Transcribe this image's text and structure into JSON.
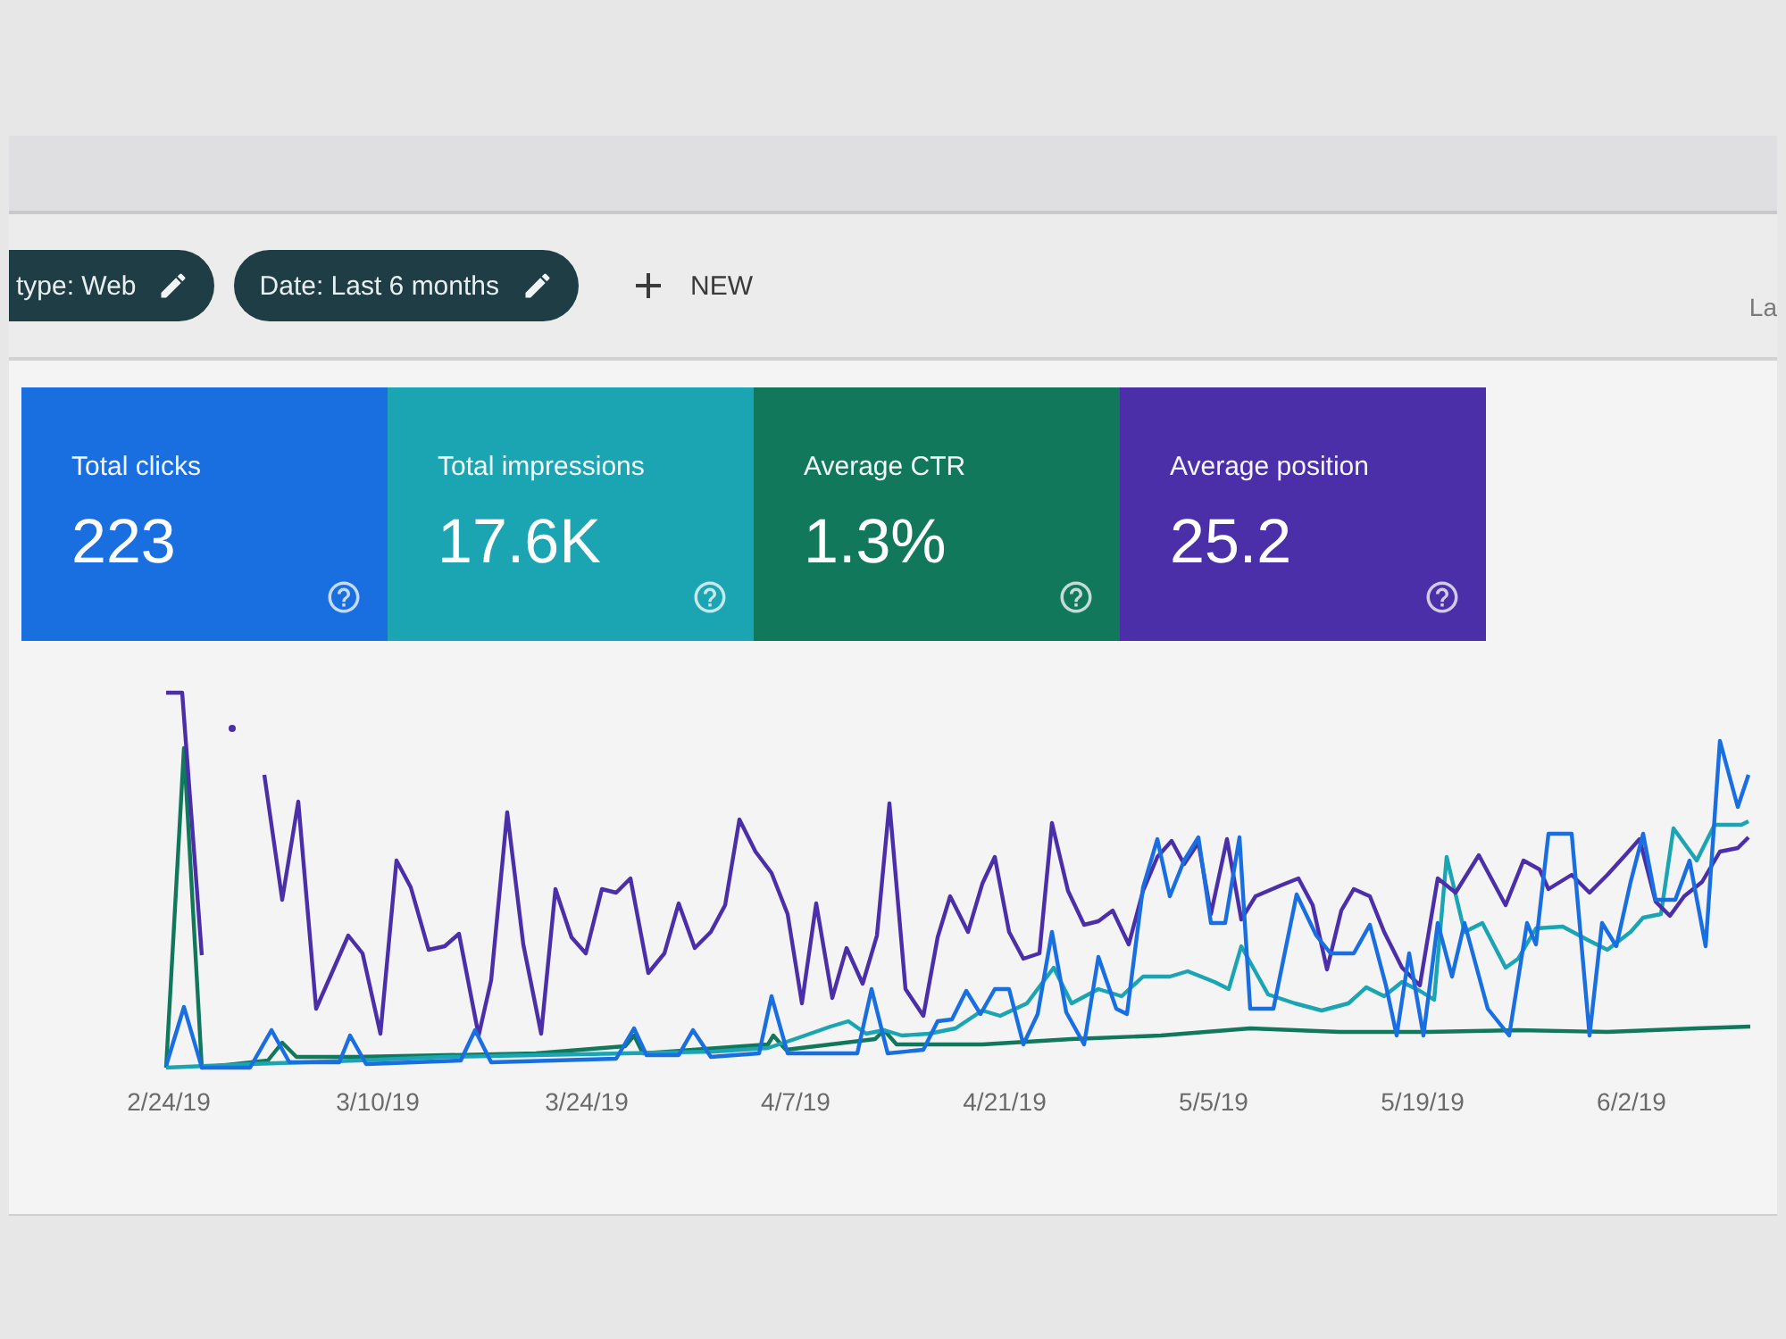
{
  "filter_bar": {
    "chips": [
      {
        "label": "type: Web"
      },
      {
        "label": "Date: Last 6 months"
      }
    ],
    "new_button": {
      "label": "NEW"
    },
    "cut_text": "La"
  },
  "cards": [
    {
      "label": "Total clicks",
      "value": "223",
      "selected": true,
      "color": "#1a6fe0"
    },
    {
      "label": "Total impressions",
      "value": "17.6K",
      "selected": true,
      "color": "#1ba5b2"
    },
    {
      "label": "Average CTR",
      "value": "1.3%",
      "selected": true,
      "color": "#12785c"
    },
    {
      "label": "Average position",
      "value": "25.2",
      "selected": true,
      "color": "#4b2fa8"
    }
  ],
  "chart": {
    "x_labels": [
      "2/24/19",
      "3/10/19",
      "3/24/19",
      "4/7/19",
      "4/21/19",
      "5/5/19",
      "5/19/19",
      "6/2/19"
    ]
  }
}
